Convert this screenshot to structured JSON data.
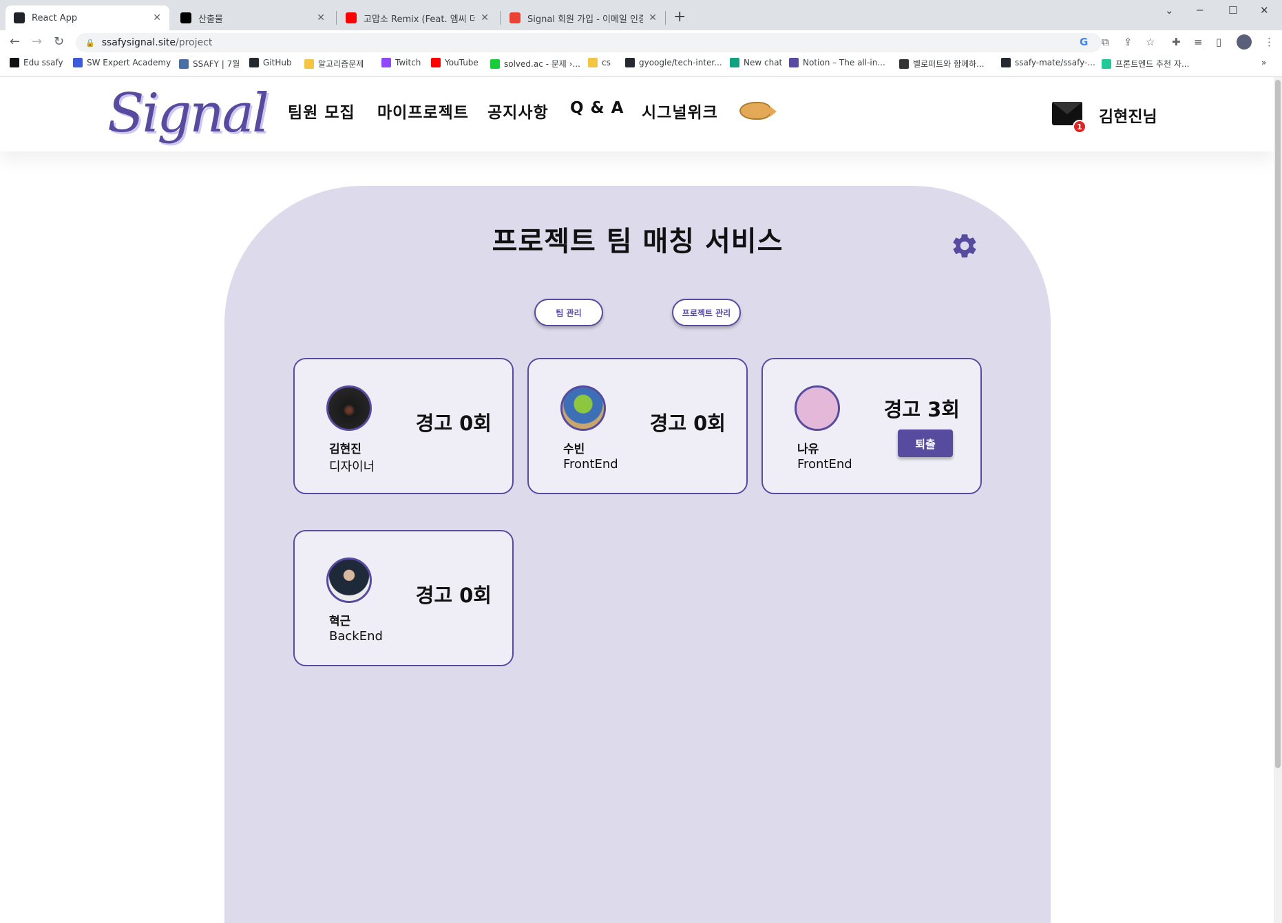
{
  "browser": {
    "tabs": [
      {
        "title": "React App",
        "active": true,
        "favicon_color": "#20232a"
      },
      {
        "title": "산출물",
        "active": false,
        "favicon_color": "#000000"
      },
      {
        "title": "고맙소 Remix (Feat. 엠씨 더 항코",
        "active": false,
        "favicon_color": "#ff0000"
      },
      {
        "title": "Signal 회원 가입 - 이메일 인증",
        "active": false,
        "favicon_color": "#ea4335"
      }
    ],
    "url_domain": "ssafysignal.site",
    "url_path": "/project",
    "bookmarks": [
      {
        "label": "Edu ssafy",
        "color": "#111111"
      },
      {
        "label": "SW Expert Academy",
        "color": "#3b5bdb"
      },
      {
        "label": "SSAFY | 7월",
        "color": "#4a6fa5"
      },
      {
        "label": "GitHub",
        "color": "#24292f"
      },
      {
        "label": "알고리즘문제",
        "color": "#f4c542"
      },
      {
        "label": "Twitch",
        "color": "#9146ff"
      },
      {
        "label": "YouTube",
        "color": "#ff0000"
      },
      {
        "label": "solved.ac - 문제 ›...",
        "color": "#17ce3a"
      },
      {
        "label": "cs",
        "color": "#f4c542"
      },
      {
        "label": "gyoogle/tech-inter...",
        "color": "#24292f"
      },
      {
        "label": "New chat",
        "color": "#10a37f"
      },
      {
        "label": "Notion – The all-in...",
        "color": "#574b9f"
      },
      {
        "label": "벨로퍼트와 함께하...",
        "color": "#333333"
      },
      {
        "label": "ssafy-mate/ssafy-...",
        "color": "#24292f"
      },
      {
        "label": "프론트엔드 추천 자...",
        "color": "#20c997"
      }
    ],
    "overflow_label": "»"
  },
  "site": {
    "logo": "Signal",
    "nav": [
      "팀원 모집",
      "마이프로젝트",
      "공지사항",
      "Q & A",
      "시그널위크"
    ],
    "mail_badge": "1",
    "user": "김현진님"
  },
  "main": {
    "title": "프로젝트 팀 매칭 서비스",
    "buttons": {
      "team_manage": "팀 관리",
      "project_manage": "프로젝트 관리"
    },
    "members": [
      {
        "name": "김현진",
        "role": "디자이너",
        "warning": "경고 0회",
        "kick": null,
        "avatar": "dark-photo"
      },
      {
        "name": "수빈",
        "role": "FrontEnd",
        "warning": "경고 0회",
        "kick": null,
        "avatar": "alien-toy"
      },
      {
        "name": "나유",
        "role": "FrontEnd",
        "warning": "경고 3회",
        "kick": "퇴출",
        "avatar": "pink-blob"
      },
      {
        "name": "혁근",
        "role": "BackEnd",
        "warning": "경고 0회",
        "kick": null,
        "avatar": "man-in-suit"
      }
    ]
  },
  "colors": {
    "brand": "#574b9f",
    "panel": "#dddaeb",
    "card": "#efeef7",
    "badge": "#e02424"
  }
}
